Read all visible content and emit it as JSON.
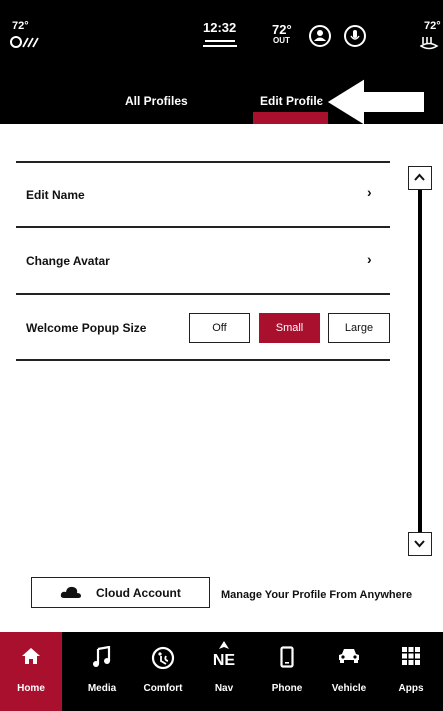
{
  "status_bar": {
    "left_temp": "72°",
    "time": "12:32",
    "out_temp": "72°",
    "out_label": "OUT",
    "right_temp": "72°",
    "icons": [
      "seat-heat-icon",
      "profile-icon",
      "microphone-icon",
      "steering-heat-icon"
    ]
  },
  "tabs": [
    {
      "label": "All Profiles",
      "active": false
    },
    {
      "label": "Edit Profile",
      "active": true
    }
  ],
  "rows": [
    {
      "label": "Edit Name",
      "chevron": "›"
    },
    {
      "label": "Change Avatar",
      "chevron": "›"
    }
  ],
  "popup_size": {
    "label": "Welcome Popup Size",
    "options": [
      {
        "label": "Off",
        "selected": false
      },
      {
        "label": "Small",
        "selected": true
      },
      {
        "label": "Large",
        "selected": false
      }
    ]
  },
  "cloud": {
    "button_label": "Cloud Account",
    "description": "Manage Your Profile From Anywhere"
  },
  "nav": {
    "items": [
      {
        "label": "Home",
        "icon": "home-icon",
        "active": true
      },
      {
        "label": "Media",
        "icon": "music-note-icon",
        "active": false
      },
      {
        "label": "Comfort",
        "icon": "comfort-icon",
        "active": false
      },
      {
        "label": "Nav",
        "icon": "compass-icon",
        "active": false,
        "heading": "NE"
      },
      {
        "label": "Phone",
        "icon": "phone-icon",
        "active": false
      },
      {
        "label": "Vehicle",
        "icon": "car-icon",
        "active": false
      },
      {
        "label": "Apps",
        "icon": "apps-grid-icon",
        "active": false
      }
    ]
  },
  "colors": {
    "accent": "#a8102e",
    "bar": "#000000",
    "background": "#ffffff"
  }
}
